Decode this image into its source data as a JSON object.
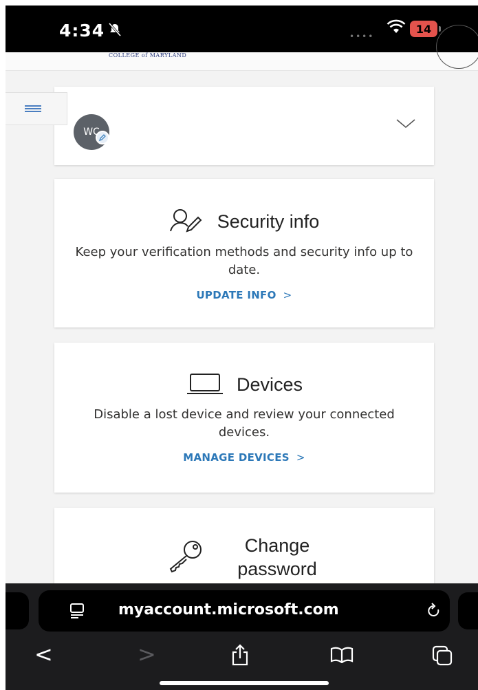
{
  "status_bar": {
    "time": "4:34",
    "battery": "14"
  },
  "header": {
    "college_logo": "COLLEGE of MARYLAND"
  },
  "profile": {
    "initials": "WC"
  },
  "cards": {
    "security": {
      "title": "Security info",
      "description": "Keep your verification methods and security info up to date.",
      "link": "UPDATE INFO",
      "arrow": ">"
    },
    "devices": {
      "title": "Devices",
      "description": "Disable a lost device and review your connected devices.",
      "link": "MANAGE DEVICES",
      "arrow": ">"
    },
    "password": {
      "title": "Change password"
    }
  },
  "browser": {
    "url": "myaccount.microsoft.com",
    "toolbar": {
      "back": "<",
      "forward": ">"
    }
  },
  "colors": {
    "link": "#2c78b8",
    "menu": "#4a7ec0",
    "battery": "#e4534d"
  }
}
